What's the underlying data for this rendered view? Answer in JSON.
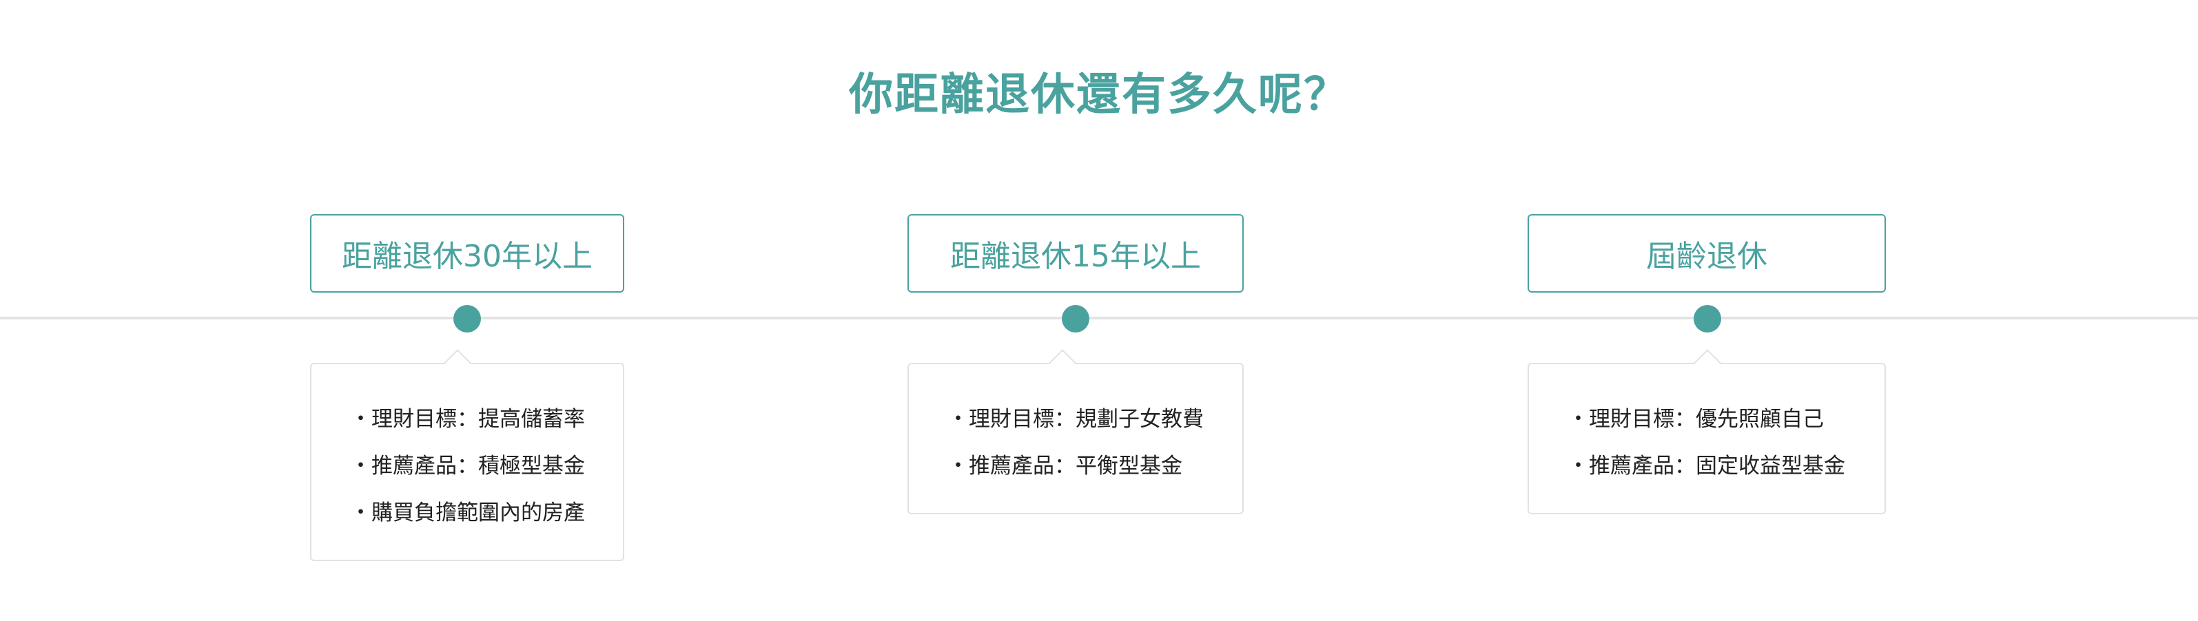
{
  "page": {
    "title": "你距離退休還有多久呢？",
    "accent_color": "#4aa29f"
  },
  "stages": [
    {
      "label": "距離退休30年以上",
      "items": [
        "・理財目標：提高儲蓄率",
        "・推薦產品：積極型基金",
        "・購買負擔範圍內的房產"
      ]
    },
    {
      "label": "距離退休15年以上",
      "items": [
        "・理財目標：規劃子女教費",
        "・推薦產品：平衡型基金"
      ]
    },
    {
      "label": "屆齡退休",
      "items": [
        "・理財目標：優先照顧自己",
        "・推薦產品：固定收益型基金"
      ]
    }
  ]
}
